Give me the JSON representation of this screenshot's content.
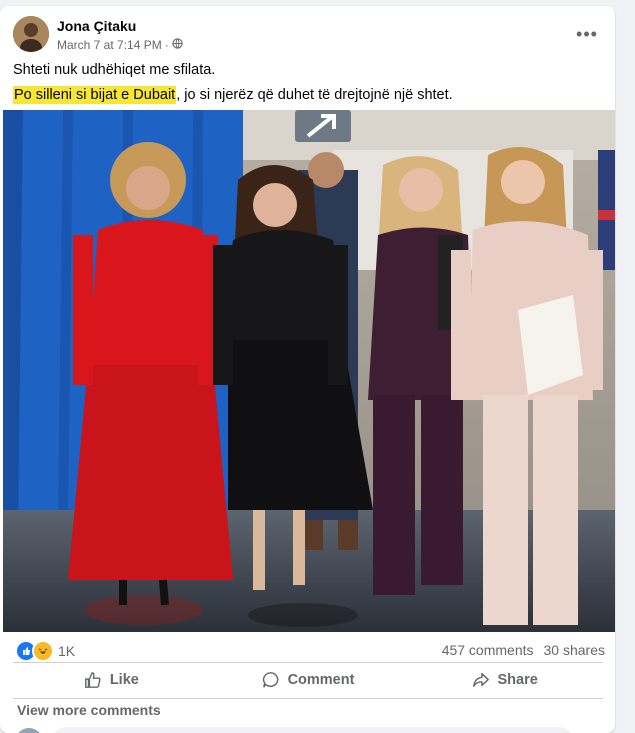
{
  "post": {
    "author": "Jona Çitaku",
    "timestamp": "March 7 at 7:14 PM",
    "separator": "·",
    "privacy_icon": "globe-icon",
    "more_label": "•••",
    "line1": "Shteti nuk udhëhiqet me sfilata.",
    "line2_highlight": "Po silleni si bijat e Dubait",
    "line2_rest": ", jo si njerëz që duhet të drejtojnë një shtet."
  },
  "photo": {
    "sign_arrow_icon": "arrow-up-right-icon"
  },
  "stats": {
    "reaction_count": "1K",
    "comments": "457 comments",
    "shares": "30 shares",
    "reaction_icons": [
      "like-icon",
      "haha-icon"
    ]
  },
  "actions": {
    "like": "Like",
    "comment": "Comment",
    "share": "Share"
  },
  "comments": {
    "view_more": "View more comments"
  },
  "colors": {
    "highlight": "#f7e734",
    "like_blue": "#1877f2",
    "haha_yellow": "#f7b928",
    "secondary_text": "#65676b"
  }
}
